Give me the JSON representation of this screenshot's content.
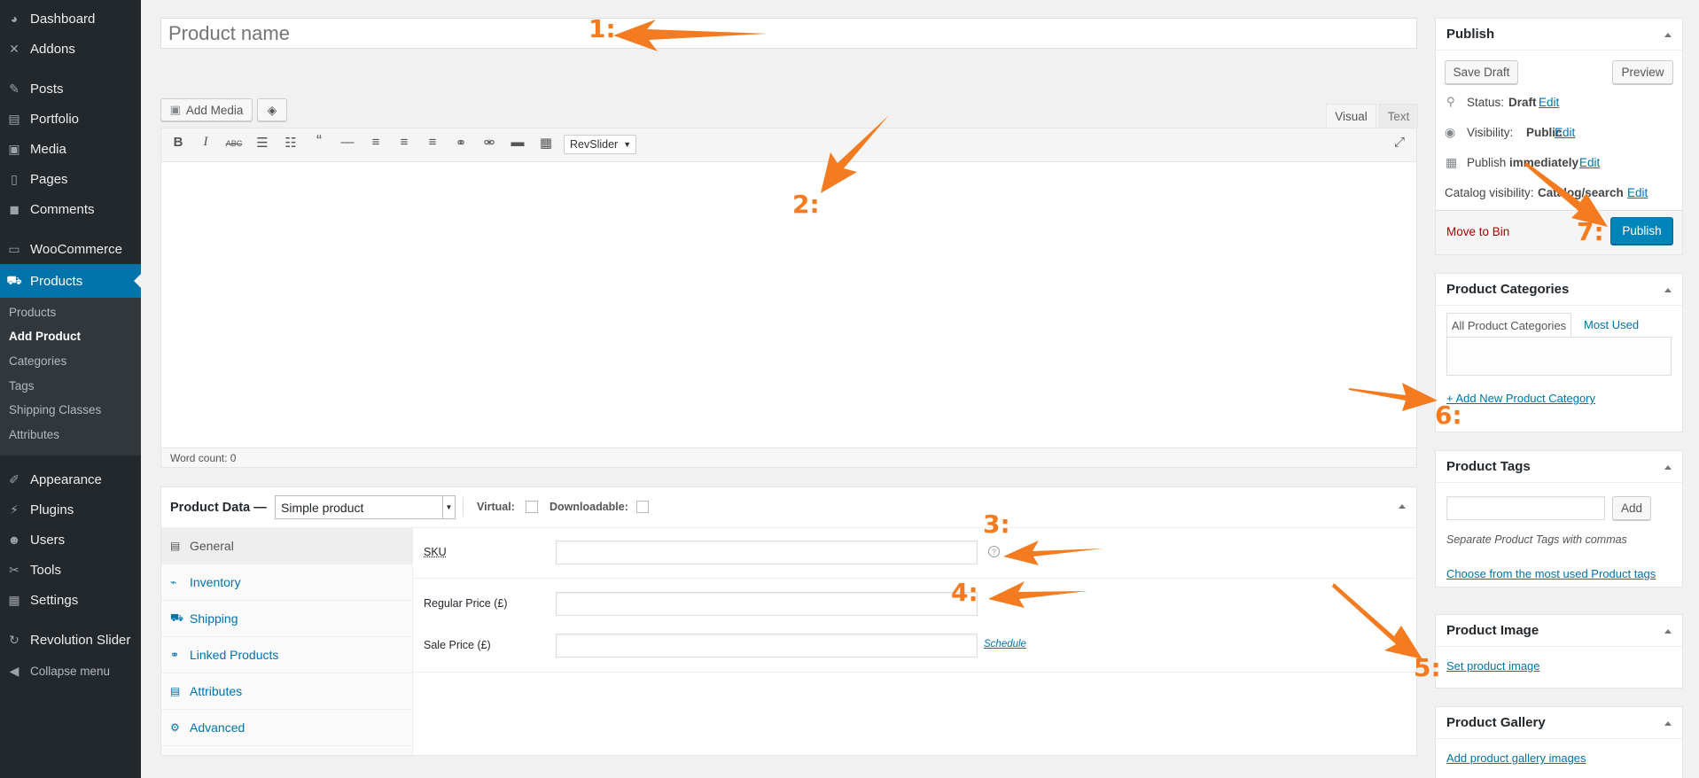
{
  "sidebar": {
    "items": [
      {
        "label": "Dashboard",
        "icon": "dashboard-icon",
        "glyph": "◕"
      },
      {
        "label": "Addons",
        "icon": "addons-icon",
        "glyph": "✕"
      },
      {
        "label": "Posts",
        "icon": "pin-icon",
        "glyph": "✎"
      },
      {
        "label": "Portfolio",
        "icon": "portfolio-icon",
        "glyph": "▤"
      },
      {
        "label": "Media",
        "icon": "media-icon",
        "glyph": "▣"
      },
      {
        "label": "Pages",
        "icon": "pages-icon",
        "glyph": "▯"
      },
      {
        "label": "Comments",
        "icon": "comments-icon",
        "glyph": "◼"
      },
      {
        "label": "WooCommerce",
        "icon": "woocommerce-icon",
        "glyph": "▭"
      },
      {
        "label": "Products",
        "icon": "cart-icon",
        "glyph": "⛟"
      }
    ],
    "submenu": [
      "Products",
      "Add Product",
      "Categories",
      "Tags",
      "Shipping Classes",
      "Attributes"
    ],
    "lower": [
      {
        "label": "Appearance",
        "icon": "brush-icon",
        "glyph": "✐"
      },
      {
        "label": "Plugins",
        "icon": "plugin-icon",
        "glyph": "⚡"
      },
      {
        "label": "Users",
        "icon": "users-icon",
        "glyph": "☻"
      },
      {
        "label": "Tools",
        "icon": "wrench-icon",
        "glyph": "✂"
      },
      {
        "label": "Settings",
        "icon": "settings-icon",
        "glyph": "▦"
      },
      {
        "label": "Revolution Slider",
        "icon": "refresh-icon",
        "glyph": "↻"
      },
      {
        "label": "Collapse menu",
        "icon": "collapse-icon",
        "glyph": "◀"
      }
    ]
  },
  "title": {
    "placeholder": "Product name"
  },
  "editor": {
    "add_media": "Add Media",
    "tab_visual": "Visual",
    "tab_text": "Text",
    "format_select": "RevSlider",
    "word_count": "Word count: 0"
  },
  "product_data": {
    "heading": "Product Data —",
    "type_select": "Simple product",
    "virtual_label": "Virtual:",
    "downloadable_label": "Downloadable:",
    "tabs": [
      "General",
      "Inventory",
      "Shipping",
      "Linked Products",
      "Attributes",
      "Advanced"
    ],
    "sku_label": "SKU",
    "regular_price_label": "Regular Price (£)",
    "sale_price_label": "Sale Price (£)",
    "schedule_link": "Schedule"
  },
  "publish": {
    "title": "Publish",
    "save_draft": "Save Draft",
    "preview": "Preview",
    "status_label": "Status:",
    "status_value": "Draft",
    "visibility_label": "Visibility:",
    "visibility_value": "Public",
    "publish_label": "Publish",
    "publish_value": "immediately",
    "catalog_label": "Catalog visibility:",
    "catalog_value": "Catalog/search",
    "edit": "Edit",
    "move_to_bin": "Move to Bin",
    "publish_button": "Publish"
  },
  "categories": {
    "title": "Product Categories",
    "tab_all": "All Product Categories",
    "tab_most_used": "Most Used",
    "add_new": "+ Add New Product Category"
  },
  "tags": {
    "title": "Product Tags",
    "add": "Add",
    "hint": "Separate Product Tags with commas",
    "choose": "Choose from the most used Product tags"
  },
  "image": {
    "title": "Product Image",
    "set": "Set product image"
  },
  "gallery": {
    "title": "Product Gallery",
    "add": "Add product gallery images"
  },
  "annotations": [
    "1:",
    "2:",
    "3:",
    "4:",
    "5:",
    "6:",
    "7:"
  ],
  "colors": {
    "accent": "#0073aa",
    "annotation": "#f47b20",
    "sidebar": "#23282d",
    "delete": "#a00"
  }
}
